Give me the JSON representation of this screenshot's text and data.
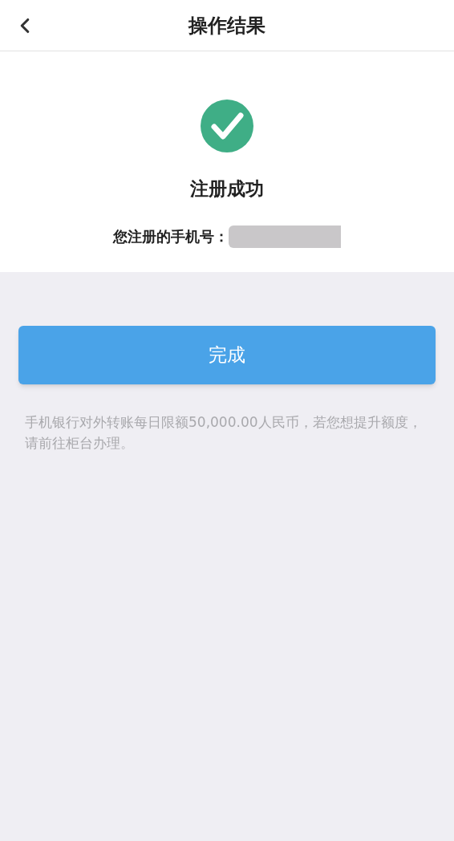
{
  "header": {
    "title": "操作结果"
  },
  "result": {
    "title": "注册成功",
    "phone_label": "您注册的手机号："
  },
  "button": {
    "label": "完成"
  },
  "note": "手机银行对外转账每日限额50,000.00人民币，若您想提升额度，请前往柜台办理。"
}
